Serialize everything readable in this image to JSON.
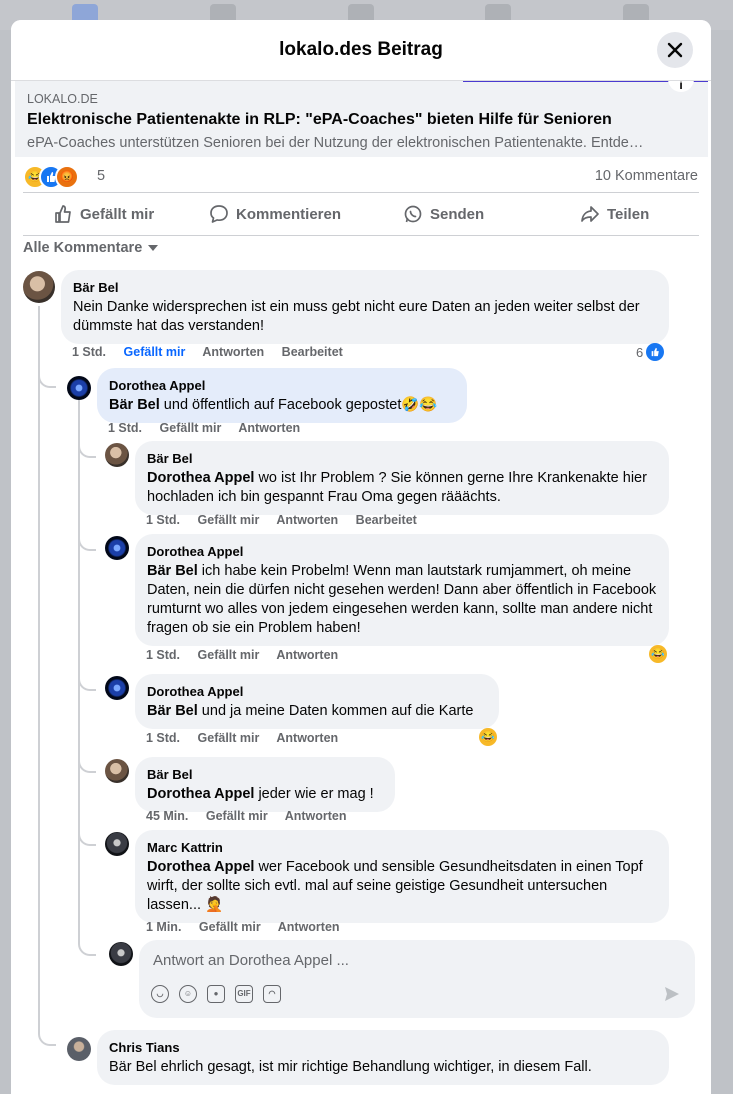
{
  "modal": {
    "title": "lokalo.des Beitrag"
  },
  "link": {
    "domain": "LOKALO.DE",
    "title": "Elektronische Patientenakte in RLP: \"ePA-Coaches\" bieten Hilfe für Senioren",
    "description": "ePA-Coaches unterstützen Senioren bei der Nutzung der elektronischen Patientenakte. Entde…"
  },
  "stats": {
    "reaction_count": "5",
    "comment_count": "10 Kommentare"
  },
  "actions": {
    "like": "Gefällt mir",
    "comment": "Kommentieren",
    "send": "Senden",
    "share": "Teilen"
  },
  "filter": {
    "label": "Alle Kommentare"
  },
  "comments": [
    {
      "author": "Bär Bel",
      "mention": "",
      "text": "Nein Danke widersprechen ist ein muss gebt nicht eure Daten an jeden weiter selbst der dümmste hat das verstanden!",
      "time": "1 Std.",
      "like": "Gefällt mir",
      "reply": "Antworten",
      "edited": "Bearbeitet",
      "reactions": "6"
    },
    {
      "author": "Dorothea Appel",
      "mention": "Bär Bel",
      "text": " und öffentlich auf Facebook gepostet🤣😂",
      "time": "1 Std.",
      "like": "Gefällt mir",
      "reply": "Antworten"
    },
    {
      "author": "Bär Bel",
      "mention": "Dorothea Appel",
      "text": " wo ist Ihr Problem ? Sie können gerne Ihre Krankenakte hier hochladen ich bin gespannt Frau Oma gegen rääächts.",
      "time": "1 Std.",
      "like": "Gefällt mir",
      "reply": "Antworten",
      "edited": "Bearbeitet"
    },
    {
      "author": "Dorothea Appel",
      "mention": "Bär Bel",
      "text": " ich habe kein Probelm! Wenn man lautstark rumjammert, oh meine Daten, nein die dürfen nicht gesehen werden! Dann aber öffentlich in Facebook rumturnt wo alles von jedem eingesehen werden kann, sollte man andere nicht fragen ob sie ein Problem haben!",
      "time": "1 Std.",
      "like": "Gefällt mir",
      "reply": "Antworten"
    },
    {
      "author": "Dorothea Appel",
      "mention": "Bär Bel",
      "text": " und ja meine Daten kommen auf die Karte",
      "time": "1 Std.",
      "like": "Gefällt mir",
      "reply": "Antworten"
    },
    {
      "author": "Bär Bel",
      "mention": "Dorothea Appel",
      "text": " jeder wie er mag !",
      "time": "45 Min.",
      "like": "Gefällt mir",
      "reply": "Antworten"
    },
    {
      "author": "Marc Kattrin",
      "mention": "Dorothea Appel",
      "text": " wer Facebook und sensible Gesundheitsdaten in einen Topf wirft, der sollte sich evtl. mal auf seine geistige Gesundheit untersuchen lassen... 🤦",
      "time": "1 Min.",
      "like": "Gefällt mir",
      "reply": "Antworten"
    },
    {
      "author": "Chris Tians",
      "mention": "",
      "text": "Bär Bel ehrlich gesagt, ist mir richtige Behandlung wichtiger, in diesem Fall."
    }
  ],
  "reply": {
    "placeholder": "Antwort an Dorothea Appel ..."
  },
  "colors": {
    "accent": "#0866ff",
    "bubble": "#f0f2f5",
    "muted": "#65676b"
  },
  "icons": [
    "close-icon",
    "thumbs-up-icon",
    "comment-icon",
    "whatsapp-icon",
    "share-icon",
    "caret-down-icon",
    "sticker-icon",
    "emoji-icon",
    "camera-icon",
    "gif-icon",
    "send-icon"
  ]
}
